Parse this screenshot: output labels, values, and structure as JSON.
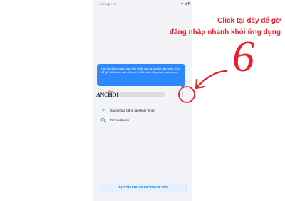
{
  "status_bar": {
    "time": "14:54",
    "left_icons": "▣ ♡ ✉",
    "right_icons": "◈ ◢ ▮"
  },
  "tooltip": {
    "text": "Lần tới đăng nhập, bạn hãy nhấn vào tài khoản của mình. Còn để gỡ tài khoản vào đó khỏi thiết bị này, hãy nhấn vào menu."
  },
  "account": {
    "logo_text": "ANCHOI",
    "logo_accent": "Hỏi",
    "menu_icon": "⋮"
  },
  "menu": [
    {
      "icon": "plus-icon",
      "glyph": "+",
      "label": "Đăng nhập bằng tài khoản khác"
    },
    {
      "icon": "search-icon",
      "glyph": "",
      "label": "Tìm tài khoản"
    }
  ],
  "create_account_button": "TẠO TÀI KHOẢN FACEBOOK MỚI",
  "annotation": {
    "line1": "Click tại đây để gỡ",
    "line2": "đăng nhập nhanh khỏi ứng dụng",
    "number": "6"
  },
  "colors": {
    "accent_blue": "#2d88ff",
    "facebook_blue": "#1877f2",
    "annotation_red": "#e8202a"
  }
}
